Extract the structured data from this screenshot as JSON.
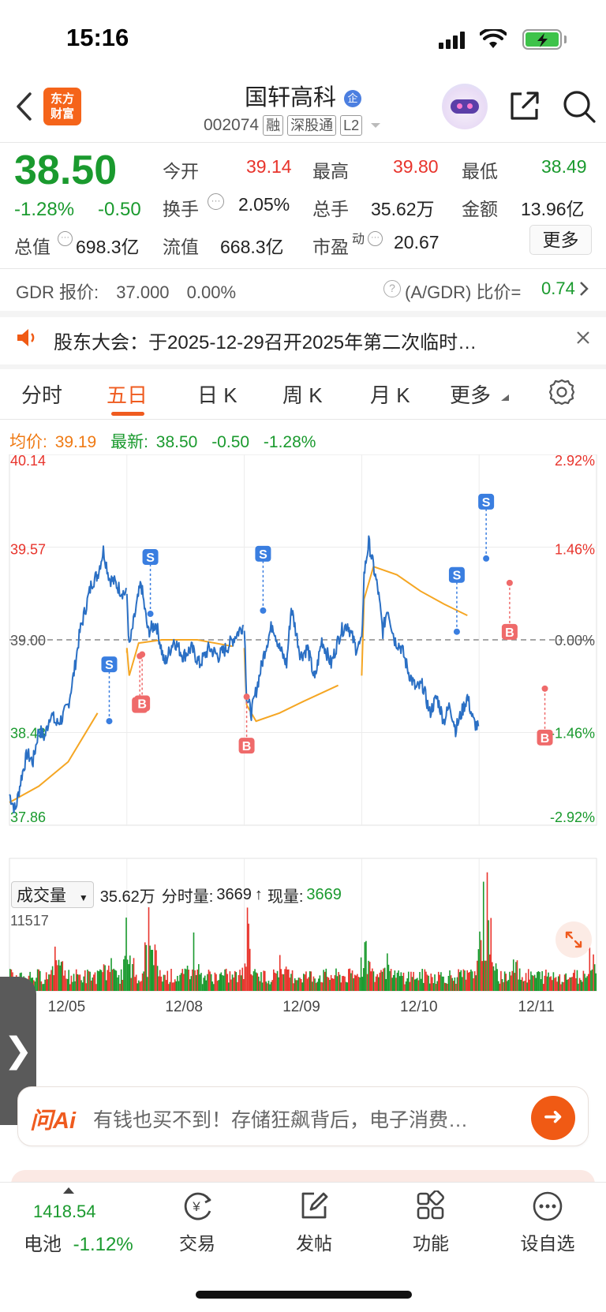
{
  "status_bar": {
    "time": "15:16"
  },
  "header": {
    "logo_text": "东方财富",
    "stock_name": "国轩高科",
    "stock_code": "002074",
    "tags": [
      "融",
      "深股通",
      "L2"
    ]
  },
  "quote": {
    "price": "38.50",
    "pct_change": "-1.28%",
    "change": "-0.50",
    "fields": {
      "open_label": "今开",
      "open": "39.14",
      "high_label": "最高",
      "high": "39.80",
      "low_label": "最低",
      "low": "38.49",
      "turnover_label": "换手",
      "turnover": "2.05%",
      "volume_label": "总手",
      "volume": "35.62万",
      "amount_label": "金额",
      "amount": "13.96亿",
      "mktcap_label": "总值",
      "mktcap": "698.3亿",
      "float_label": "流值",
      "float": "668.3亿",
      "pe_label": "市盈",
      "pe_sup": "动",
      "pe": "20.67"
    },
    "more_label": "更多"
  },
  "gdr": {
    "label": "GDR 报价:",
    "price": "37.000",
    "pct": "0.00%",
    "ratio_label": "(A/GDR) 比价=",
    "ratio": "0.74"
  },
  "notice": {
    "text": "股东大会：于2025-12-29召开2025年第二次临时…"
  },
  "tabs": [
    "分时",
    "五日",
    "日 K",
    "周 K",
    "月 K",
    "更多"
  ],
  "active_tab": "五日",
  "summary_line": {
    "avg_label": "均价:",
    "avg": "39.19",
    "latest_label": "最新:",
    "latest": "38.50",
    "chg": "-0.50",
    "pct": "-1.28%"
  },
  "chart_data": {
    "type": "line",
    "title": "",
    "y_labels_left": [
      "40.14",
      "39.57",
      "39.00",
      "38.43",
      "37.86"
    ],
    "y_labels_right": [
      "2.92%",
      "1.46%",
      "0.00%",
      "-1.46%",
      "-2.92%"
    ],
    "ylim": [
      37.86,
      40.14
    ],
    "x_labels": [
      "12/05",
      "12/08",
      "12/09",
      "12/10",
      "12/11"
    ],
    "series": [],
    "price_points": [
      [
        0.0,
        38.05
      ],
      [
        0.05,
        37.95
      ],
      [
        0.1,
        38.15
      ],
      [
        0.15,
        38.3
      ],
      [
        0.2,
        38.25
      ],
      [
        0.25,
        38.45
      ],
      [
        0.3,
        38.4
      ],
      [
        0.35,
        38.55
      ],
      [
        0.4,
        38.48
      ],
      [
        0.45,
        38.52
      ],
      [
        0.5,
        38.6
      ],
      [
        0.55,
        38.8
      ],
      [
        0.6,
        39.05
      ],
      [
        0.65,
        39.2
      ],
      [
        0.7,
        39.35
      ],
      [
        0.75,
        39.4
      ],
      [
        0.8,
        39.55
      ],
      [
        0.85,
        39.38
      ],
      [
        0.9,
        39.35
      ],
      [
        0.95,
        39.3
      ],
      [
        1.0,
        39.28
      ],
      [
        1.02,
        38.95
      ],
      [
        1.08,
        39.2
      ],
      [
        1.12,
        39.35
      ],
      [
        1.18,
        39.05
      ],
      [
        1.25,
        39.1
      ],
      [
        1.32,
        38.85
      ],
      [
        1.4,
        39.0
      ],
      [
        1.48,
        38.9
      ],
      [
        1.55,
        38.95
      ],
      [
        1.62,
        38.85
      ],
      [
        1.7,
        38.95
      ],
      [
        1.78,
        38.9
      ],
      [
        1.85,
        38.95
      ],
      [
        1.95,
        39.05
      ],
      [
        2.0,
        39.1
      ],
      [
        2.02,
        38.65
      ],
      [
        2.06,
        38.55
      ],
      [
        2.12,
        38.75
      ],
      [
        2.18,
        38.95
      ],
      [
        2.24,
        39.1
      ],
      [
        2.3,
        38.95
      ],
      [
        2.36,
        38.85
      ],
      [
        2.4,
        39.2
      ],
      [
        2.48,
        38.9
      ],
      [
        2.54,
        38.95
      ],
      [
        2.6,
        38.75
      ],
      [
        2.66,
        39.0
      ],
      [
        2.74,
        38.85
      ],
      [
        2.82,
        39.05
      ],
      [
        2.88,
        39.1
      ],
      [
        2.95,
        38.95
      ],
      [
        3.0,
        38.98
      ],
      [
        3.02,
        39.4
      ],
      [
        3.06,
        39.6
      ],
      [
        3.1,
        39.45
      ],
      [
        3.14,
        39.3
      ],
      [
        3.18,
        39.05
      ],
      [
        3.22,
        39.2
      ],
      [
        3.28,
        39.0
      ],
      [
        3.34,
        38.95
      ],
      [
        3.4,
        38.8
      ],
      [
        3.46,
        38.7
      ],
      [
        3.52,
        38.72
      ],
      [
        3.58,
        38.55
      ],
      [
        3.64,
        38.65
      ],
      [
        3.7,
        38.5
      ],
      [
        3.75,
        38.6
      ],
      [
        3.8,
        38.45
      ],
      [
        3.85,
        38.55
      ],
      [
        3.9,
        38.65
      ],
      [
        3.95,
        38.5
      ],
      [
        4.0,
        38.45
      ]
    ],
    "avg_points": [
      [
        0.0,
        38.0
      ],
      [
        0.25,
        38.1
      ],
      [
        0.5,
        38.25
      ],
      [
        0.75,
        38.55
      ],
      [
        1.0,
        38.92
      ],
      [
        1.0,
        38.95
      ],
      [
        1.02,
        38.78
      ],
      [
        1.1,
        38.98
      ],
      [
        1.3,
        39.0
      ],
      [
        1.6,
        39.0
      ],
      [
        1.9,
        38.96
      ],
      [
        2.0,
        38.95
      ],
      [
        2.02,
        38.6
      ],
      [
        2.1,
        38.5
      ],
      [
        2.3,
        38.55
      ],
      [
        2.5,
        38.62
      ],
      [
        2.8,
        38.72
      ],
      [
        3.0,
        38.78
      ],
      [
        3.02,
        39.25
      ],
      [
        3.1,
        39.45
      ],
      [
        3.3,
        39.4
      ],
      [
        3.5,
        39.3
      ],
      [
        3.7,
        39.22
      ],
      [
        3.9,
        39.15
      ],
      [
        4.0,
        39.1
      ]
    ],
    "trade_marks": [
      {
        "label": "S",
        "x": 0.85,
        "y": 38.5
      },
      {
        "label": "B",
        "x": 1.11,
        "y": 38.9
      },
      {
        "label": "B",
        "x": 1.13,
        "y": 38.91
      },
      {
        "label": "S",
        "x": 1.2,
        "y": 39.16
      },
      {
        "label": "B",
        "x": 2.02,
        "y": 38.65
      },
      {
        "label": "S",
        "x": 2.16,
        "y": 39.18
      },
      {
        "label": "S",
        "x": 3.81,
        "y": 39.05
      },
      {
        "label": "S",
        "x": 4.06,
        "y": 39.5
      },
      {
        "label": "B",
        "x": 4.26,
        "y": 39.35
      },
      {
        "label": "B",
        "x": 4.56,
        "y": 38.7
      }
    ]
  },
  "volume": {
    "dropdown_label": "成交量",
    "total": "35.62万",
    "tick_label": "分时量:",
    "tick_value": "3669",
    "now_label": "现量:",
    "now_value": "3669",
    "max_label": "11517"
  },
  "ai_bar": {
    "logo": "问Ai",
    "text": "有钱也买不到！存储狂飙背后，电子消费…"
  },
  "bottom_nav": {
    "index_value": "1418.54",
    "index_name": "电池",
    "index_pct": "-1.12%",
    "items": [
      "交易",
      "发帖",
      "功能",
      "设自选"
    ]
  },
  "colors": {
    "up": "#e8342c",
    "down": "#1a9a2e",
    "accent": "#ef5b1f",
    "price_line": "#2a6fc4",
    "avg_line": "#f5a623"
  }
}
